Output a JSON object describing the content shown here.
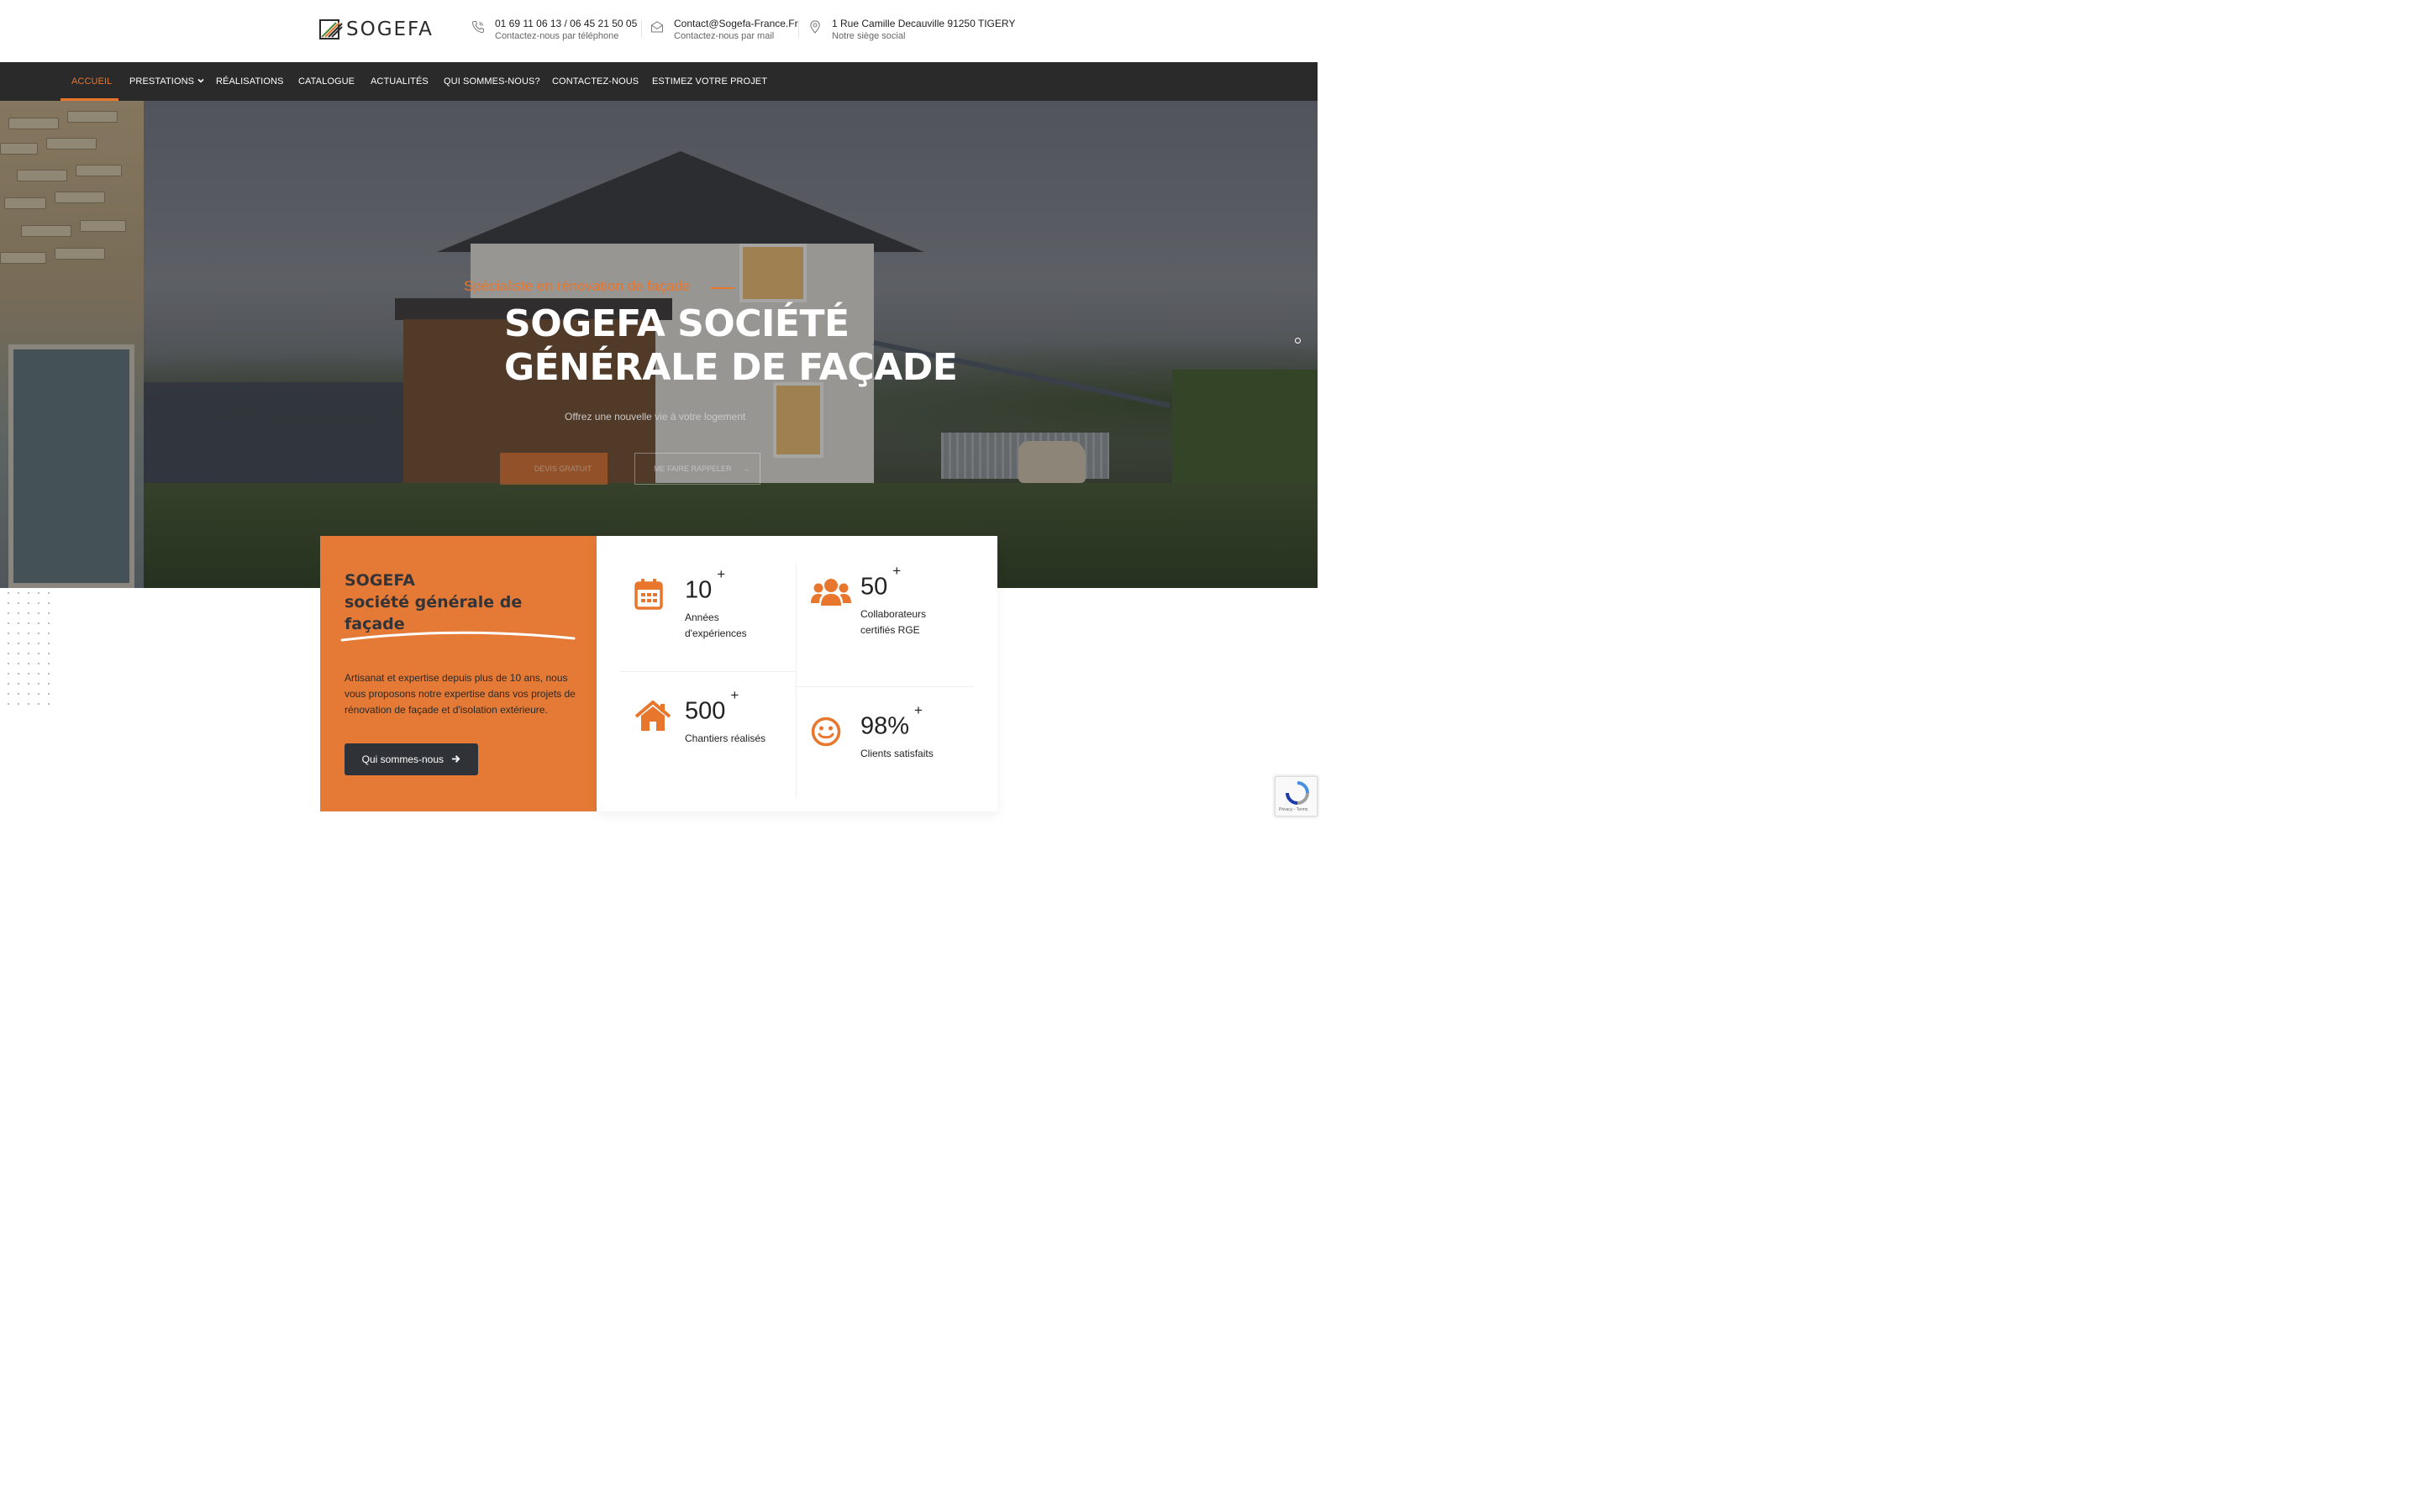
{
  "header": {
    "logo_text": "SOGEFA",
    "phone": {
      "main": "01 69 11 06 13 / 06 45 21 50 05",
      "sub": "Contactez-nous par téléphone"
    },
    "email": {
      "main": "Contact@Sogefa-France.Fr",
      "sub": "Contactez-nous par mail"
    },
    "address": {
      "main": "1 Rue Camille Decauville 91250 TIGERY",
      "sub": "Notre siège social"
    }
  },
  "nav": {
    "items": [
      {
        "label": "ACCUEIL"
      },
      {
        "label": "PRESTATIONS"
      },
      {
        "label": "RÉALISATIONS"
      },
      {
        "label": "CATALOGUE"
      },
      {
        "label": "ACTUALITÉS"
      },
      {
        "label": "QUI SOMMES-NOUS?"
      },
      {
        "label": "CONTACTEZ-NOUS"
      },
      {
        "label": "ESTIMEZ VOTRE PROJET"
      }
    ],
    "accent_color": "#e8762d",
    "bg_color": "#2a2a2a"
  },
  "hero": {
    "subtitle": "Spécialiste en rénovation de façade",
    "title_line1": "SOGEFA SOCIÉTÉ",
    "title_line2": "GÉNÉRALE DE FAÇADE",
    "tagline": "Offrez une nouvelle vie à votre logement",
    "btn_quote": "DEVIS GRATUIT",
    "btn_call": "ME FAIRE RAPPELER",
    "btn_call_arrow": "→"
  },
  "about": {
    "title_line1": "SOGEFA",
    "title_line2": "société générale de",
    "title_line3": "façade",
    "text": "Artisanat et expertise depuis plus de 10 ans, nous vous proposons notre expertise dans vos projets de rénovation de façade et d'isolation extérieure.",
    "button": "Qui sommes-nous",
    "bg_color": "#e47a35"
  },
  "stats": [
    {
      "icon": "calendar-icon",
      "value": "10",
      "suffix": "+",
      "label_line1": "Années",
      "label_line2": "d'expériences"
    },
    {
      "icon": "users-icon",
      "value": "50",
      "suffix": "+",
      "label_line1": "Collaborateurs",
      "label_line2": "certifiés RGE"
    },
    {
      "icon": "home-icon",
      "value": "500",
      "suffix": "+",
      "label_line1": "Chantiers réalisés",
      "label_line2": ""
    },
    {
      "icon": "smile-icon",
      "value": "98%",
      "suffix": "+",
      "label_line1": "Clients satisfaits",
      "label_line2": ""
    }
  ],
  "recaptcha": {
    "label": "Privacy - Terms"
  }
}
